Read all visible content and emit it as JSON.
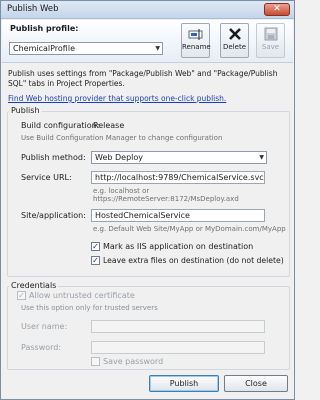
{
  "window": {
    "title": "Publish Web",
    "close_glyph": "✕"
  },
  "profile": {
    "label": "Publish profile:",
    "selected": "ChemicalProfile",
    "buttons": {
      "rename": "Rename",
      "delete": "Delete",
      "save": "Save"
    }
  },
  "description": "Publish uses settings from \"Package/Publish Web\" and \"Package/Publish SQL\" tabs in Project Properties.",
  "hosting_link": "Find Web hosting provider that supports one-click publish.",
  "publish_group": {
    "title": "Publish",
    "build_config_label": "Build configuration:",
    "build_config_value": "Release",
    "build_config_hint": "Use Build Configuration Manager to change configuration",
    "method_label": "Publish method:",
    "method_value": "Web Deploy",
    "service_url_label": "Service URL:",
    "service_url_value": "http://localhost:9789/ChemicalService.svc",
    "service_url_hint": "e.g. localhost or https://RemoteServer:8172/MsDeploy.axd",
    "site_label": "Site/application:",
    "site_value": "HostedChemicalService",
    "site_hint": "e.g. Default Web Site/MyApp or MyDomain.com/MyApp",
    "mark_iis_label": "Mark as IIS application on destination",
    "mark_iis_checked": true,
    "leave_extra_label": "Leave extra files on destination (do not delete)",
    "leave_extra_checked": true
  },
  "credentials": {
    "title": "Credentials",
    "allow_untrusted_label": "Allow untrusted certificate",
    "allow_untrusted_checked": true,
    "trusted_hint": "Use this option only for trusted servers",
    "username_label": "User name:",
    "username_value": "",
    "password_label": "Password:",
    "password_value": "",
    "save_password_label": "Save password",
    "save_password_checked": false
  },
  "footer": {
    "publish": "Publish",
    "close": "Close"
  },
  "check_glyph": "✓"
}
